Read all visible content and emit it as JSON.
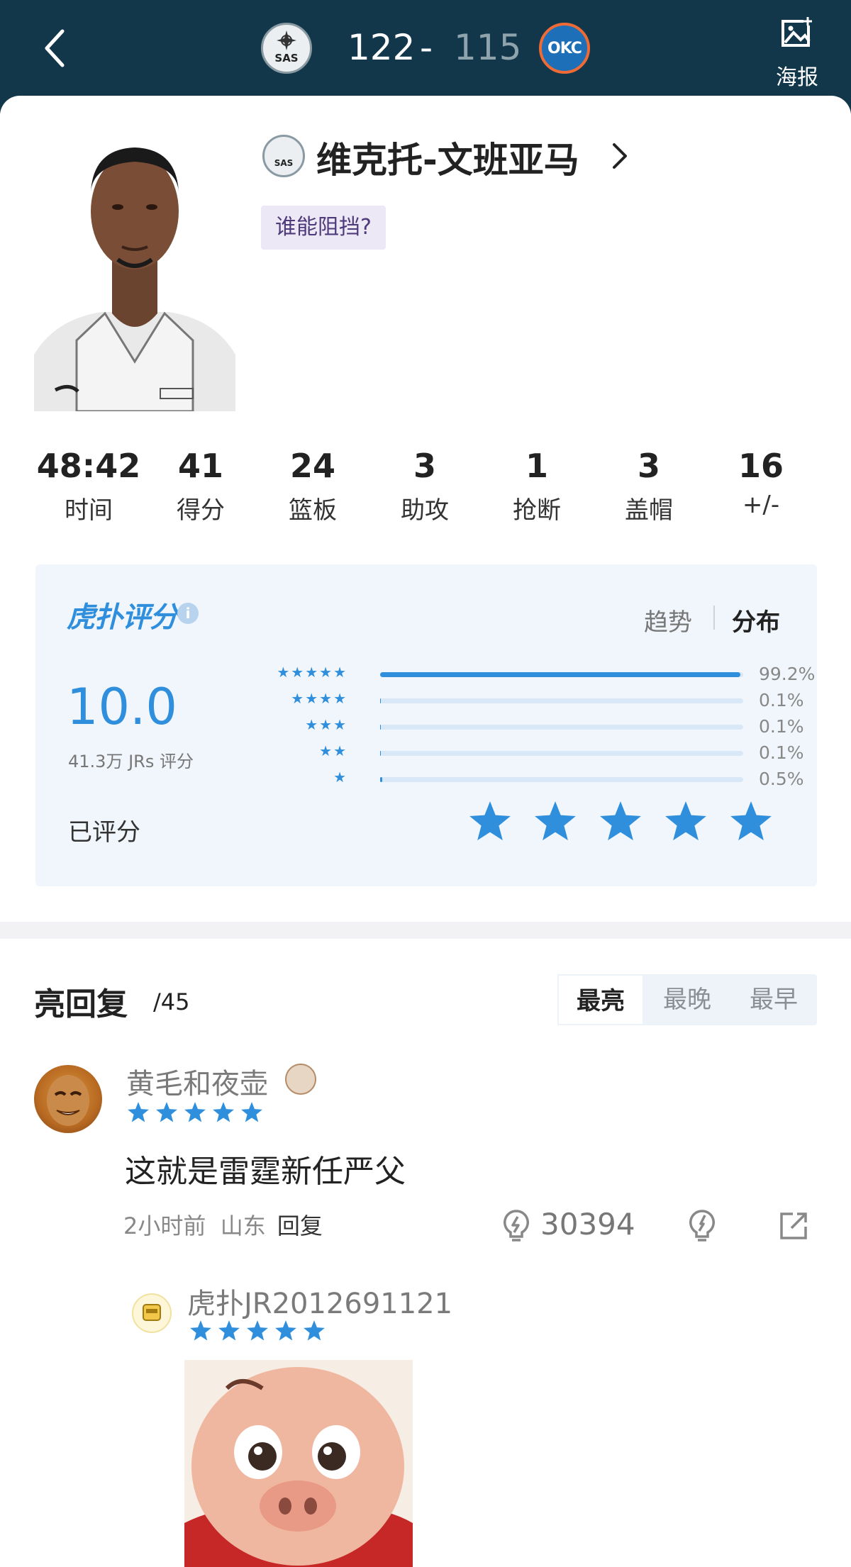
{
  "header": {
    "home_team_logo": "SAS",
    "home_score": "122",
    "dash": "-",
    "away_score": "115",
    "away_team_logo": "OKC",
    "poster_label": "海报",
    "colors": {
      "bar": "#12374a",
      "away_score": "#8fa3ad"
    }
  },
  "player": {
    "team_logo": "SAS",
    "name": "维克托-文班亚马",
    "tag": "谁能阻挡?"
  },
  "stats": [
    {
      "value": "48:42",
      "label": "时间"
    },
    {
      "value": "41",
      "label": "得分"
    },
    {
      "value": "24",
      "label": "篮板"
    },
    {
      "value": "3",
      "label": "助攻"
    },
    {
      "value": "1",
      "label": "抢断"
    },
    {
      "value": "3",
      "label": "盖帽"
    },
    {
      "value": "16",
      "label": "+/-"
    }
  ],
  "rating": {
    "brand": "虎扑评分",
    "brand_mark": "®",
    "info_icon": "i",
    "tab_trend": "趋势",
    "tab_distribution": "分布",
    "score": "10.0",
    "votes": "41.3万 JRs 评分",
    "rated_label": "已评分",
    "my_rating_stars": 5,
    "accent_color": "#2f8fdc",
    "distribution": [
      {
        "stars": 5,
        "stars_text": "★★★★★",
        "percent": 99.2,
        "label": "99.2%"
      },
      {
        "stars": 4,
        "stars_text": "★★★★",
        "percent": 0.1,
        "label": "0.1%"
      },
      {
        "stars": 3,
        "stars_text": "★★★",
        "percent": 0.1,
        "label": "0.1%"
      },
      {
        "stars": 2,
        "stars_text": "★★",
        "percent": 0.1,
        "label": "0.1%"
      },
      {
        "stars": 1,
        "stars_text": "★",
        "percent": 0.5,
        "label": "0.5%"
      }
    ]
  },
  "replies": {
    "title": "亮回复",
    "count": "/45",
    "sort_tabs": [
      "最亮",
      "最晚",
      "最早"
    ],
    "active_sort": 0,
    "comments": [
      {
        "user": "黄毛和夜壶",
        "stars": 5,
        "text": "这就是雷霆新任严父",
        "time": "2小时前",
        "location": "山东",
        "reply_label": "回复",
        "likes": "30394"
      },
      {
        "user": "虎扑JR2012691121",
        "stars": 5
      }
    ]
  }
}
